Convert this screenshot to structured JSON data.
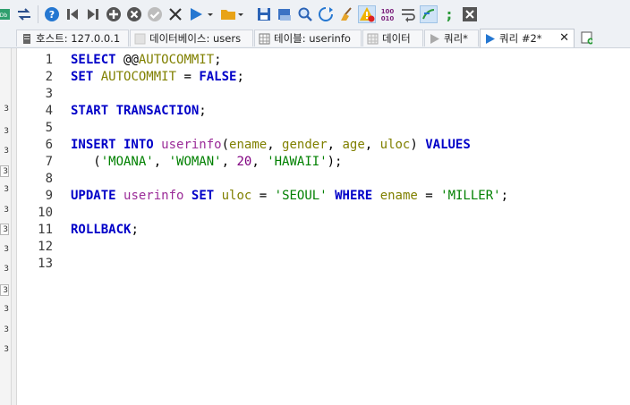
{
  "tabs": [
    {
      "label": "호스트: 127.0.0.1",
      "icon": "server-icon"
    },
    {
      "label": "데이터베이스: users",
      "icon": "database-icon"
    },
    {
      "label": "테이블: userinfo",
      "icon": "table-icon"
    },
    {
      "label": "데이터",
      "icon": "data-grid-icon"
    },
    {
      "label": "쿼리*",
      "icon": "play-icon"
    },
    {
      "label": "쿼리 #2*",
      "icon": "play-icon",
      "active": true
    }
  ],
  "left_strip_digits": [
    "3",
    "3",
    "3",
    "3",
    "3",
    "3",
    "3",
    "3",
    "3",
    "3",
    "3",
    "3",
    "3"
  ],
  "editor": {
    "line_numbers": [
      "1",
      "2",
      "3",
      "4",
      "5",
      "6",
      "7",
      "8",
      "9",
      "10",
      "11",
      "12",
      "13"
    ],
    "lines": [
      [
        {
          "t": "SELECT",
          "c": "kw"
        },
        {
          "t": " ",
          "c": "pl"
        },
        {
          "t": "@@",
          "c": "pl"
        },
        {
          "t": "AUTOCOMMIT",
          "c": "cn"
        },
        {
          "t": ";",
          "c": "pl"
        }
      ],
      [
        {
          "t": "SET",
          "c": "kw"
        },
        {
          "t": " ",
          "c": "pl"
        },
        {
          "t": "AUTOCOMMIT",
          "c": "cn"
        },
        {
          "t": " = ",
          "c": "pl"
        },
        {
          "t": "FALSE",
          "c": "kw"
        },
        {
          "t": ";",
          "c": "pl"
        }
      ],
      [],
      [
        {
          "t": "START TRANSACTION",
          "c": "kw"
        },
        {
          "t": ";",
          "c": "pl"
        }
      ],
      [],
      [
        {
          "t": "INSERT INTO",
          "c": "kw"
        },
        {
          "t": " ",
          "c": "pl"
        },
        {
          "t": "userinfo",
          "c": "id"
        },
        {
          "t": "(",
          "c": "pl"
        },
        {
          "t": "ename",
          "c": "cn"
        },
        {
          "t": ", ",
          "c": "pl"
        },
        {
          "t": "gender",
          "c": "cn"
        },
        {
          "t": ", ",
          "c": "pl"
        },
        {
          "t": "age",
          "c": "cn"
        },
        {
          "t": ", ",
          "c": "pl"
        },
        {
          "t": "uloc",
          "c": "cn"
        },
        {
          "t": ") ",
          "c": "pl"
        },
        {
          "t": "VALUES",
          "c": "kw"
        }
      ],
      [
        {
          "t": "   (",
          "c": "pl"
        },
        {
          "t": "'MOANA'",
          "c": "st"
        },
        {
          "t": ", ",
          "c": "pl"
        },
        {
          "t": "'WOMAN'",
          "c": "st"
        },
        {
          "t": ", ",
          "c": "pl"
        },
        {
          "t": "20",
          "c": "nm"
        },
        {
          "t": ", ",
          "c": "pl"
        },
        {
          "t": "'HAWAII'",
          "c": "st"
        },
        {
          "t": ");",
          "c": "pl"
        }
      ],
      [],
      [
        {
          "t": "UPDATE",
          "c": "kw"
        },
        {
          "t": " ",
          "c": "pl"
        },
        {
          "t": "userinfo",
          "c": "id"
        },
        {
          "t": " ",
          "c": "pl"
        },
        {
          "t": "SET",
          "c": "kw"
        },
        {
          "t": " ",
          "c": "pl"
        },
        {
          "t": "uloc",
          "c": "cn"
        },
        {
          "t": " = ",
          "c": "pl"
        },
        {
          "t": "'SEOUL'",
          "c": "st"
        },
        {
          "t": " ",
          "c": "pl"
        },
        {
          "t": "WHERE",
          "c": "kw"
        },
        {
          "t": " ",
          "c": "pl"
        },
        {
          "t": "ename",
          "c": "cn"
        },
        {
          "t": " = ",
          "c": "pl"
        },
        {
          "t": "'MILLER'",
          "c": "st"
        },
        {
          "t": ";",
          "c": "pl"
        }
      ],
      [],
      [
        {
          "t": "ROLLBACK",
          "c": "kw"
        },
        {
          "t": ";",
          "c": "pl"
        }
      ],
      [],
      []
    ]
  },
  "colors": {
    "keyword": "#0000c8",
    "identifier": "#9b2c98",
    "column": "#808000",
    "string": "#008000",
    "number": "#800080"
  }
}
